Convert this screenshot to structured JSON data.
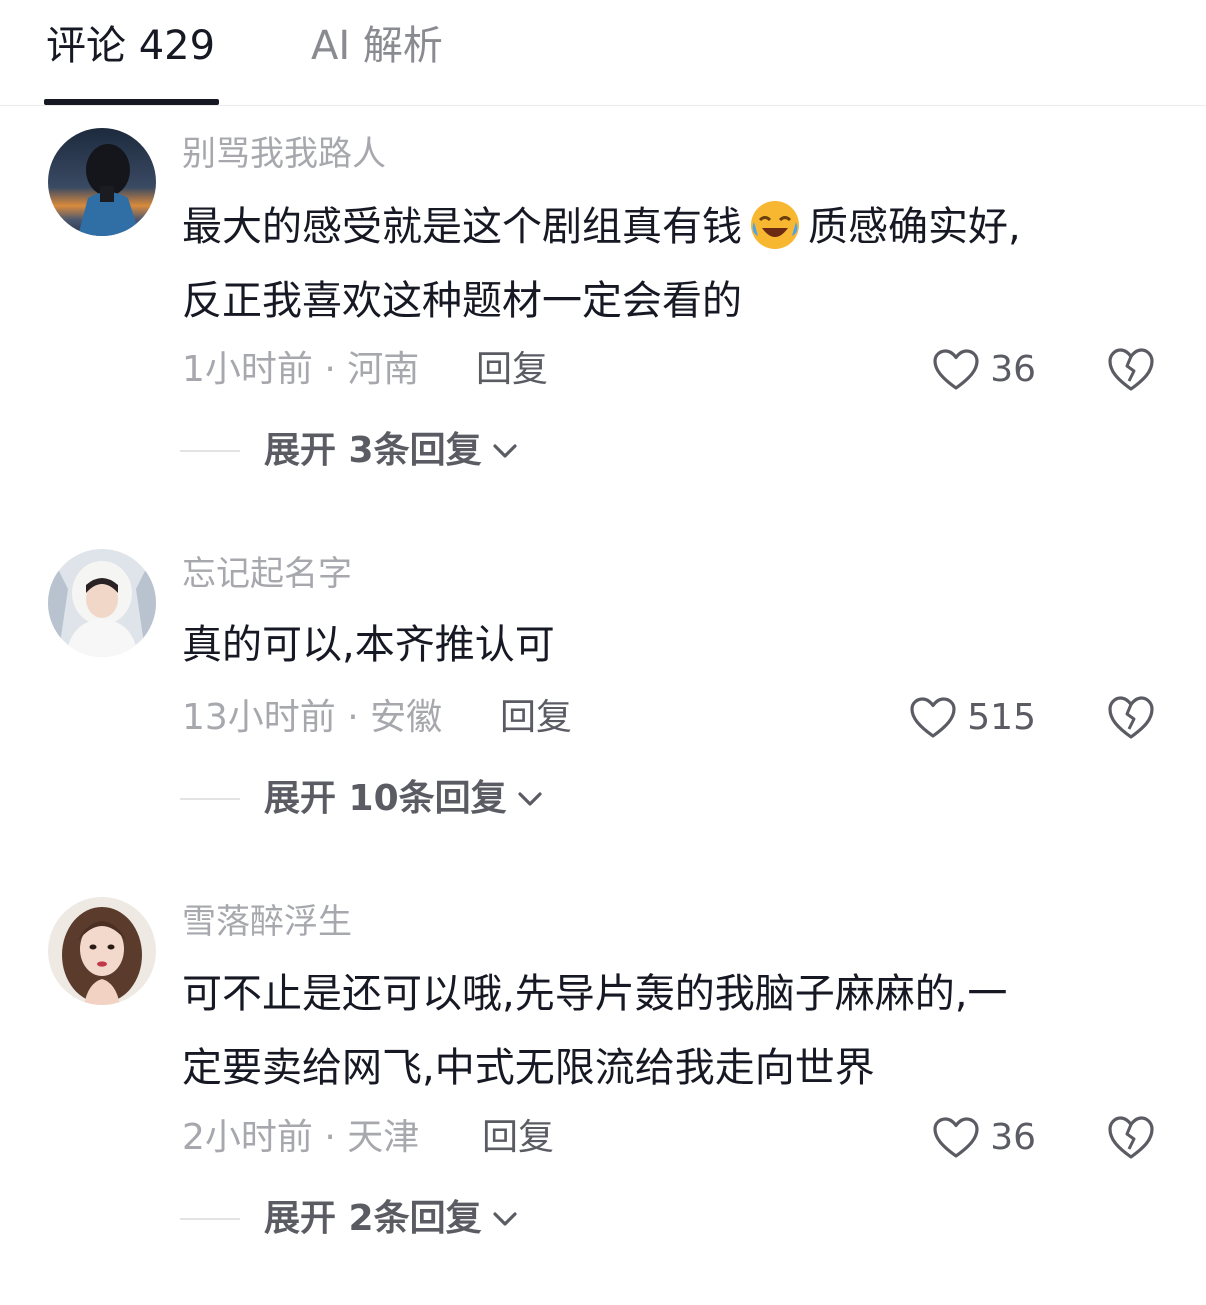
{
  "tabs": [
    {
      "label": "评论 429",
      "active": true
    },
    {
      "label": "AI 解析",
      "active": false
    }
  ],
  "comments": [
    {
      "username": "别骂我我路人",
      "text_line1": "最大的感受就是这个剧组真有钱",
      "emoji": "laughing-crying-emoji",
      "text_line1b": "质感确实好,",
      "text_line2": "反正我喜欢这种题材一定会看的",
      "meta": "1小时前 · 河南",
      "reply_label": "回复",
      "likes": "36",
      "expand_label": "展开 3条回复"
    },
    {
      "username": "忘记起名字",
      "text_line1": "真的可以,本齐推认可",
      "meta": "13小时前 · 安徽",
      "reply_label": "回复",
      "likes": "515",
      "expand_label": "展开 10条回复"
    },
    {
      "username": "雪落醉浮生",
      "text_line1": "可不止是还可以哦,先导片轰的我脑子麻麻的,一",
      "text_line2": "定要卖给网飞,中式无限流给我走向世界",
      "meta": "2小时前 · 天津",
      "reply_label": "回复",
      "likes": "36",
      "expand_label": "展开 2条回复"
    }
  ],
  "colors": {
    "primary_text": "#161823",
    "secondary_text": "#a7a8ad",
    "action_text": "#5b5c63",
    "divider": "#ececec"
  }
}
